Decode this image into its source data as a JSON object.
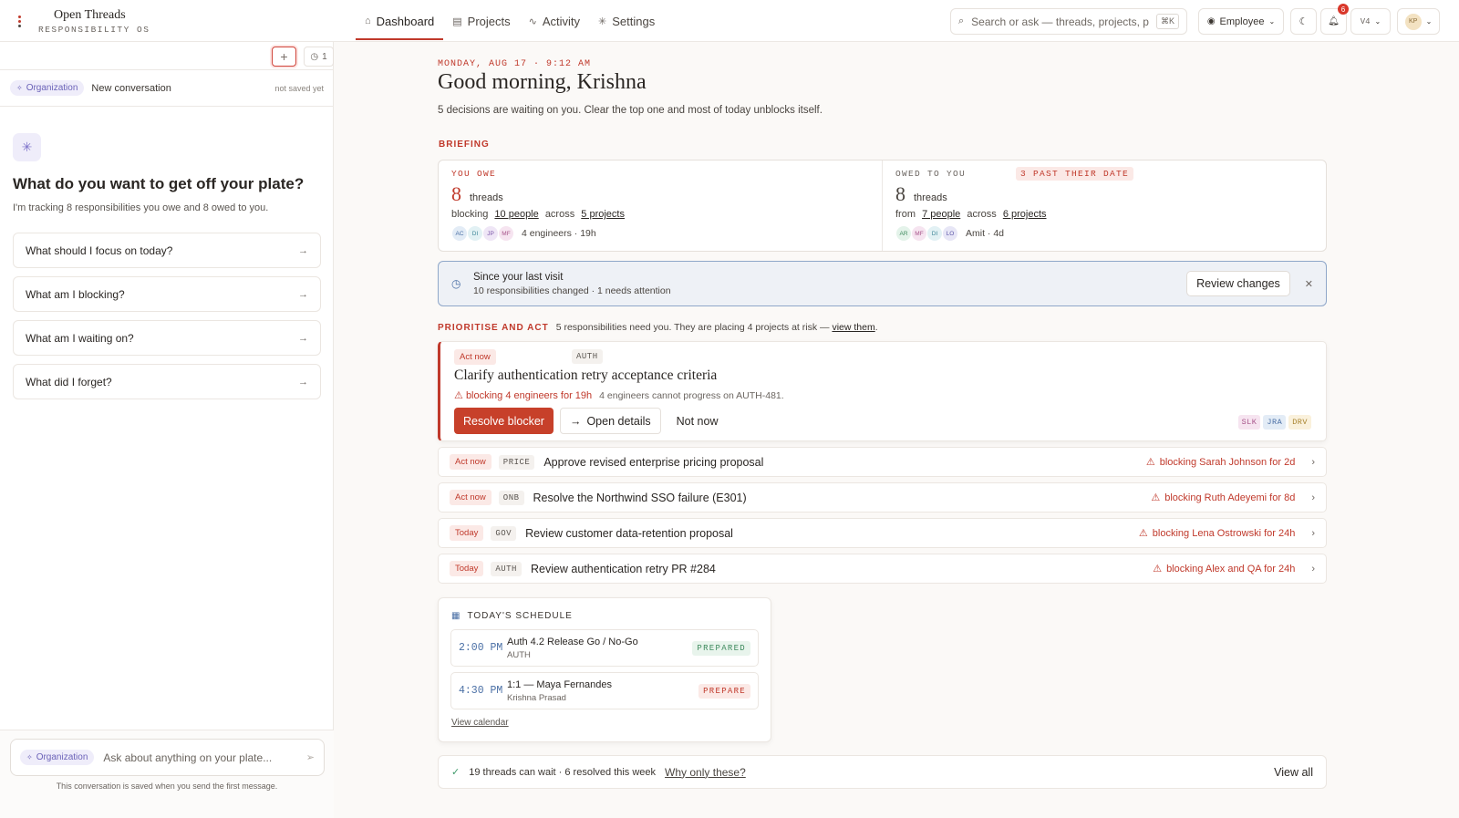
{
  "app": {
    "name": "Open Threads",
    "subtitle": "RESPONSIBILITY OS",
    "colors": {
      "accent": "#c0392b",
      "accent_soft": "#fbe9e6",
      "info": "#4a6fa5",
      "org": "#6b62b8"
    }
  },
  "nav": {
    "items": [
      {
        "label": "Dashboard",
        "icon": "home-icon",
        "active": true
      },
      {
        "label": "Projects",
        "icon": "folder-icon",
        "active": false
      },
      {
        "label": "Activity",
        "icon": "activity-icon",
        "active": false
      },
      {
        "label": "Settings",
        "icon": "gear-icon",
        "active": false
      }
    ]
  },
  "topbar": {
    "search_placeholder": "Search or ask — threads, projects, p",
    "search_shortcut": "⌘K",
    "role_label": "Employee",
    "notification_count": "6",
    "version_label": "V4",
    "user_initials": "KP"
  },
  "sidebar": {
    "history_count": "1",
    "scope_chip": "Organization",
    "conversation_title": "New conversation",
    "conversation_status": "not saved yet",
    "heading": "What do you want to get off your plate?",
    "subtext": "I'm tracking 8 responsibilities you owe and 8 owed to you.",
    "suggestions": [
      "What should I focus on today?",
      "What am I blocking?",
      "What am I waiting on?",
      "What did I forget?"
    ],
    "ask_scope_chip": "Organization",
    "ask_placeholder": "Ask about anything on your plate...",
    "ask_note": "This conversation is saved when you send the first message."
  },
  "main": {
    "date_line": "MONDAY, AUG 17 · 9:12 AM",
    "greeting": "Good morning, Krishna",
    "greeting_sub": "5 decisions are waiting on you. Clear the top one and most of today unblocks itself.",
    "briefing_label": "BRIEFING",
    "you_owe": {
      "tag": "YOU OWE",
      "count": "8",
      "unit": "threads",
      "meta_prefix": "blocking",
      "people": "10 people",
      "meta_mid": "across",
      "projects": "5 projects",
      "avatars": [
        "AC",
        "DI",
        "JP",
        "MF"
      ],
      "avatar_note": "4 engineers · 19h"
    },
    "owed_to_you": {
      "tag": "OWED TO YOU",
      "late_tag": "3 PAST THEIR DATE",
      "count": "8",
      "unit": "threads",
      "meta_prefix": "from",
      "people": "7 people",
      "meta_mid": "across",
      "projects": "6 projects",
      "avatars": [
        "AR",
        "MF",
        "DI",
        "LO"
      ],
      "avatar_note": "Amit · 4d"
    },
    "since_visit": {
      "title": "Since your last visit",
      "detail": "10 responsibilities changed · 1 needs attention",
      "button": "Review changes"
    },
    "prioritise": {
      "label": "PRIORITISE AND ACT",
      "text": "5 responsibilities need you. They are placing 4 projects at risk —",
      "link": "view them",
      "suffix": "."
    },
    "hero_task": {
      "status": "Act now",
      "code": "AUTH",
      "title": "Clarify authentication retry acceptance criteria",
      "warning": "blocking 4 engineers for 19h",
      "detail": "4 engineers cannot progress on AUTH-481.",
      "primary_action": "Resolve blocker",
      "secondary_action": "Open details",
      "tertiary_action": "Not now",
      "sources": [
        "SLK",
        "JRA",
        "DRV"
      ]
    },
    "tasks": [
      {
        "status": "Act now",
        "code": "PRICE",
        "title": "Approve revised enterprise pricing proposal",
        "blocking": "blocking Sarah Johnson for 2d"
      },
      {
        "status": "Act now",
        "code": "ONB",
        "title": "Resolve the Northwind SSO failure (E301)",
        "blocking": "blocking Ruth Adeyemi for 8d"
      },
      {
        "status": "Today",
        "code": "GOV",
        "title": "Review customer data-retention proposal",
        "blocking": "blocking Lena Ostrowski for 24h"
      },
      {
        "status": "Today",
        "code": "AUTH",
        "title": "Review authentication retry PR #284",
        "blocking": "blocking Alex and QA for 24h"
      }
    ],
    "schedule": {
      "label": "TODAY'S SCHEDULE",
      "items": [
        {
          "time": "2:00 PM",
          "title": "Auth 4.2 Release Go / No-Go",
          "sub": "AUTH",
          "status": "PREPARED"
        },
        {
          "time": "4:30 PM",
          "title": "1:1 — Maya Fernandes",
          "sub": "Krishna Prasad",
          "status": "PREPARE"
        }
      ],
      "link": "View calendar"
    },
    "footer": {
      "text": "19 threads can wait · 6 resolved this week",
      "link": "Why only these?",
      "view_all": "View all"
    }
  }
}
